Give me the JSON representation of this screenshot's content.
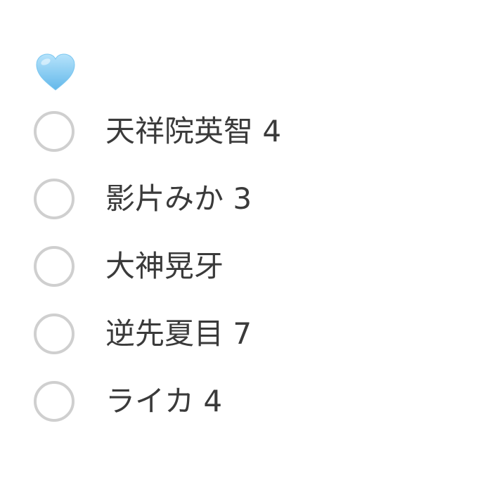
{
  "header": {
    "icon": "light-blue-heart-icon",
    "icon_color": "#7cc7f0"
  },
  "poll": {
    "options": [
      {
        "label": "天祥院英智 4"
      },
      {
        "label": "影片みか 3"
      },
      {
        "label": "大神晃牙"
      },
      {
        "label": "逆先夏目 7"
      },
      {
        "label": "ライカ 4"
      }
    ]
  },
  "colors": {
    "text": "#3a3a3a",
    "radio_border": "#cfcfcf",
    "background": "#ffffff"
  }
}
